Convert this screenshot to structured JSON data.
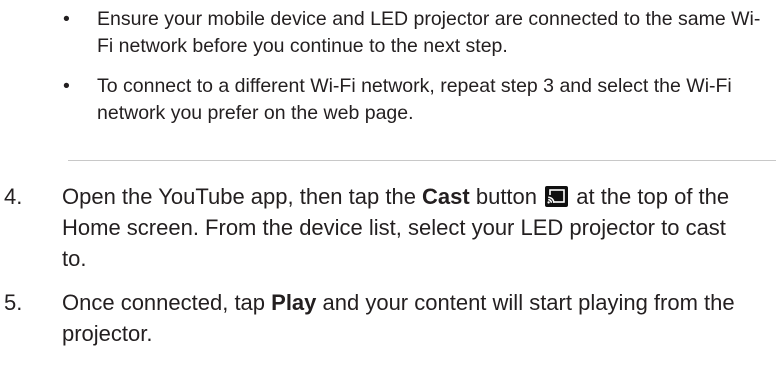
{
  "notes": [
    {
      "bullet": "•",
      "text": "Ensure your mobile device and LED projector are connected to the same Wi-Fi network before you continue to the next step."
    },
    {
      "bullet": "•",
      "text": "To connect to a different Wi-Fi network, repeat step 3 and select the Wi-Fi network you prefer on the web page."
    }
  ],
  "steps": [
    {
      "number": "4.",
      "text_before": "Open the YouTube app, then tap the ",
      "bold": "Cast",
      "text_middle": " button ",
      "icon": "cast-icon",
      "text_after": " at the top of the Home screen. From the device list, select your LED projector to cast to."
    },
    {
      "number": "5.",
      "text_before": "Once connected, tap ",
      "bold": "Play",
      "text_after": " and your content will start playing from the projector."
    }
  ],
  "colors": {
    "text": "#231f20",
    "divider": "#c8c8c8",
    "icon_background": "#0f0f0f",
    "icon_foreground": "#ffffff"
  }
}
